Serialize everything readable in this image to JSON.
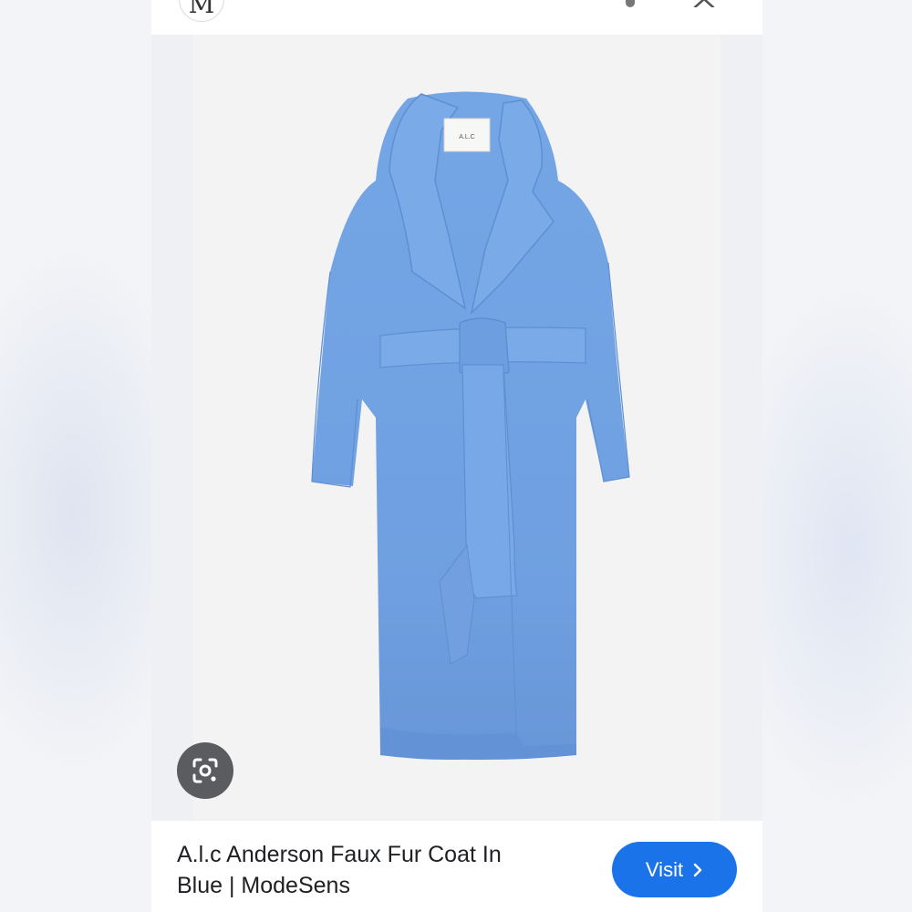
{
  "header": {
    "site_avatar_letter": "M",
    "more_icon": "more-vert-icon",
    "close_icon": "close-icon"
  },
  "image": {
    "label_text": "A.L.C",
    "lens_icon": "google-lens-icon",
    "coat_color": "#6e9fe0"
  },
  "result": {
    "title_line1": "A.l.c Anderson Faux Fur Coat In",
    "title_line2": "Blue | ModeSens",
    "visit_label": "Visit",
    "visit_icon": "chevron-right-icon",
    "visit_color": "#1a73e8"
  }
}
